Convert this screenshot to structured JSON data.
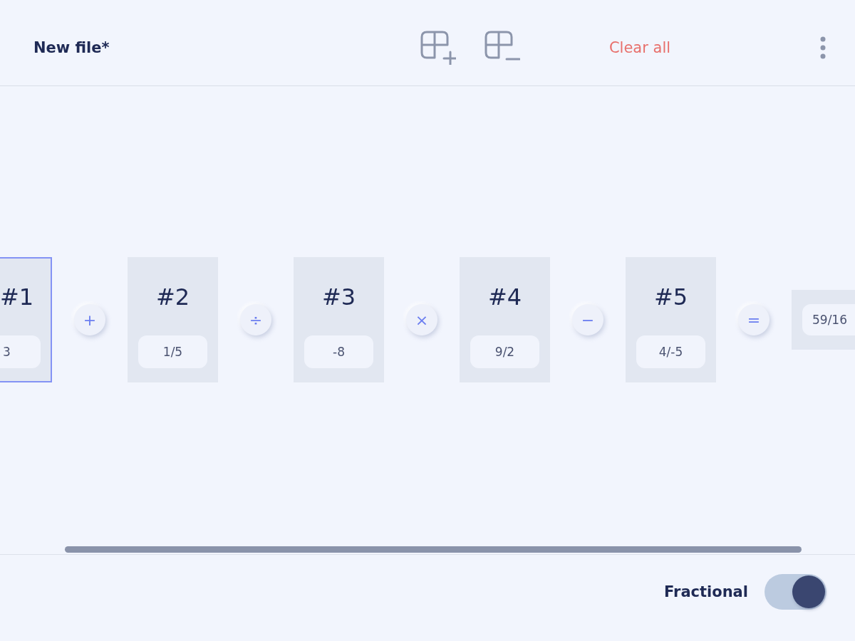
{
  "header": {
    "title": "New file*",
    "clear_label": "Clear all"
  },
  "sequence": [
    {
      "kind": "operand",
      "label": "#1",
      "value": "3",
      "selected": true
    },
    {
      "kind": "operator",
      "symbol": "+"
    },
    {
      "kind": "operand",
      "label": "#2",
      "value": "1/5",
      "selected": false
    },
    {
      "kind": "operator",
      "symbol": "÷"
    },
    {
      "kind": "operand",
      "label": "#3",
      "value": "-8",
      "selected": false
    },
    {
      "kind": "operator",
      "symbol": "×"
    },
    {
      "kind": "operand",
      "label": "#4",
      "value": "9/2",
      "selected": false
    },
    {
      "kind": "operator",
      "symbol": "−"
    },
    {
      "kind": "operand",
      "label": "#5",
      "value": "4/-5",
      "selected": false
    },
    {
      "kind": "operator",
      "symbol": "="
    },
    {
      "kind": "result",
      "value": "59/16"
    }
  ],
  "footer": {
    "label": "Fractional",
    "on": true
  }
}
